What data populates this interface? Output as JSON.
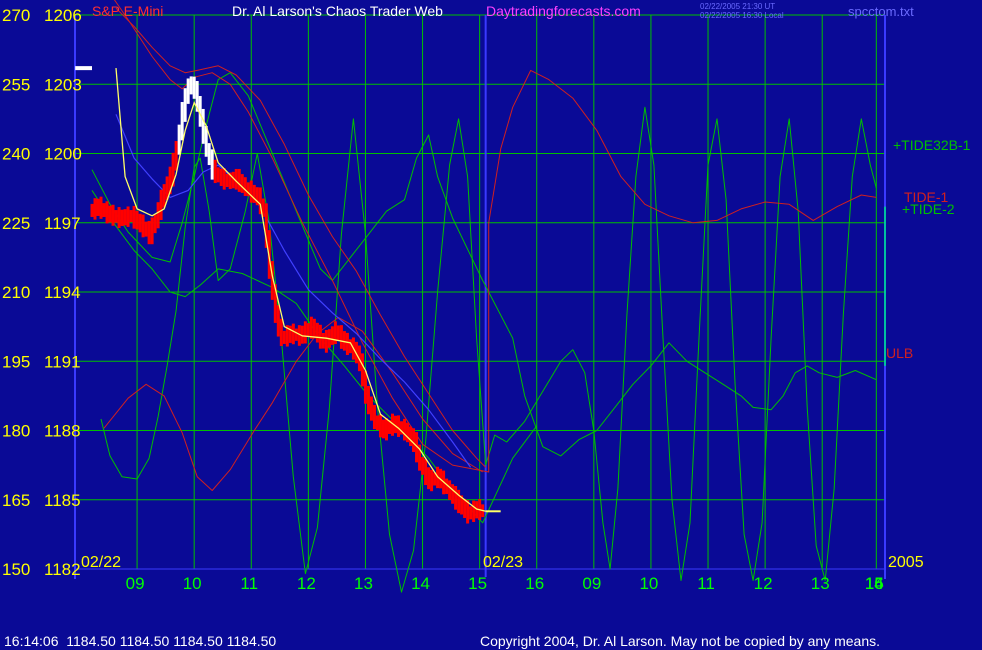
{
  "header": {
    "symbol": "S&P E-Mini",
    "title": "Dr. Al Larson's Chaos Trader Web",
    "site": "Daytradingforecasts.com",
    "timestamp_ut": "02/22/2005 21:30 UT",
    "timestamp_local": "02/22/2005 16:30 Local",
    "file": "spcctom.txt"
  },
  "footer": {
    "quote": "16:14:06  1184.50 1184.50 1184.50 1184.50",
    "copyright": "Copyright 2004, Dr. Al Larson. May not be copied by any means."
  },
  "date_labels": {
    "day1": "02/22",
    "day2": "02/23",
    "year": "2005"
  },
  "colors": {
    "background": "#0a0a96",
    "grid": "#00c000",
    "axis": "#3a3aff",
    "price_up": "#ffffff",
    "price_down": "#ff0000",
    "tide": "#00c000",
    "envelope": "#d02020",
    "ma_fast": "#ffff66",
    "ma_slow": "#4040ff",
    "left_labels": "#ffff00",
    "time_labels": "#00ff00",
    "site": "#ff40ff"
  },
  "chart_data": {
    "type": "line",
    "title": "S&P E-Mini",
    "left_axis_tide": [
      270,
      255,
      240,
      225,
      210,
      195,
      180,
      165,
      150
    ],
    "left_axis_price": [
      1206,
      1203,
      1200,
      1197,
      1194,
      1191,
      1188,
      1185,
      1182
    ],
    "ylim_price": [
      1182,
      1206
    ],
    "x_ticks": [
      "09",
      "10",
      "11",
      "12",
      "13",
      "14",
      "15",
      "16",
      "09",
      "10",
      "11",
      "12",
      "13",
      "14",
      "15",
      "16"
    ],
    "series_labels": [
      "+TIDE32B-1",
      "TIDE-1",
      "+TIDE-2",
      "ULB"
    ],
    "price": [
      [
        0,
        1197.5
      ],
      [
        0.15,
        1197.7
      ],
      [
        0.3,
        1197.4
      ],
      [
        0.5,
        1197.2
      ],
      [
        0.7,
        1197.3
      ],
      [
        0.9,
        1196.8
      ],
      [
        1.0,
        1196.5
      ],
      [
        1.1,
        1197.1
      ],
      [
        1.2,
        1198.0
      ],
      [
        1.35,
        1199.0
      ],
      [
        1.45,
        1200.2
      ],
      [
        1.55,
        1201.8
      ],
      [
        1.65,
        1203.0
      ],
      [
        1.75,
        1202.8
      ],
      [
        1.85,
        1201.5
      ],
      [
        1.95,
        1200.2
      ],
      [
        2.05,
        1199.3
      ],
      [
        2.15,
        1199.0
      ],
      [
        2.3,
        1198.8
      ],
      [
        2.45,
        1198.9
      ],
      [
        2.6,
        1198.5
      ],
      [
        2.8,
        1198.1
      ],
      [
        2.9,
        1197.5
      ],
      [
        3.0,
        1195.0
      ],
      [
        3.1,
        1193.0
      ],
      [
        3.2,
        1192.0
      ],
      [
        3.35,
        1192.2
      ],
      [
        3.5,
        1192.1
      ],
      [
        3.7,
        1192.5
      ],
      [
        3.9,
        1191.8
      ],
      [
        4.1,
        1192.3
      ],
      [
        4.25,
        1191.8
      ],
      [
        4.4,
        1191.5
      ],
      [
        4.5,
        1191.0
      ],
      [
        4.6,
        1189.5
      ],
      [
        4.75,
        1188.4
      ],
      [
        4.9,
        1188.0
      ],
      [
        5.05,
        1188.3
      ],
      [
        5.25,
        1188.0
      ],
      [
        5.4,
        1187.5
      ],
      [
        5.5,
        1186.6
      ],
      [
        5.65,
        1185.8
      ],
      [
        5.8,
        1186.0
      ],
      [
        5.95,
        1185.5
      ],
      [
        6.1,
        1185.0
      ],
      [
        6.3,
        1184.4
      ],
      [
        6.45,
        1184.6
      ],
      [
        6.55,
        1184.5
      ]
    ],
    "ma_fast": [
      [
        0.4,
        1203.7
      ],
      [
        0.55,
        1199.0
      ],
      [
        0.75,
        1197.6
      ],
      [
        1.0,
        1197.3
      ],
      [
        1.2,
        1197.6
      ],
      [
        1.4,
        1199.1
      ],
      [
        1.55,
        1201.0
      ],
      [
        1.7,
        1202.2
      ],
      [
        1.9,
        1201.2
      ],
      [
        2.1,
        1199.6
      ],
      [
        2.4,
        1198.8
      ],
      [
        2.8,
        1197.8
      ],
      [
        3.0,
        1194.7
      ],
      [
        3.2,
        1192.5
      ],
      [
        3.5,
        1192.1
      ],
      [
        3.9,
        1192.0
      ],
      [
        4.3,
        1191.8
      ],
      [
        4.55,
        1190.6
      ],
      [
        4.8,
        1188.7
      ],
      [
        5.1,
        1188.1
      ],
      [
        5.45,
        1187.2
      ],
      [
        5.75,
        1186.0
      ],
      [
        6.1,
        1185.2
      ],
      [
        6.4,
        1184.6
      ],
      [
        6.55,
        1184.5
      ]
    ],
    "ma_slow": [
      [
        0.4,
        1201.7
      ],
      [
        0.7,
        1199.8
      ],
      [
        1.0,
        1198.9
      ],
      [
        1.3,
        1198.1
      ],
      [
        1.6,
        1198.4
      ],
      [
        1.85,
        1199.2
      ],
      [
        2.1,
        1199.5
      ],
      [
        2.4,
        1198.8
      ],
      [
        2.8,
        1197.7
      ],
      [
        3.2,
        1195.8
      ],
      [
        3.6,
        1194.1
      ],
      [
        4.0,
        1193.1
      ],
      [
        4.4,
        1192.2
      ],
      [
        4.8,
        1191.1
      ],
      [
        5.2,
        1190.1
      ],
      [
        5.6,
        1188.9
      ],
      [
        6.0,
        1187.5
      ],
      [
        6.3,
        1186.4
      ]
    ],
    "env_upper": [
      [
        0.4,
        1206.3
      ],
      [
        0.7,
        1205.5
      ],
      [
        1.0,
        1204.6
      ],
      [
        1.3,
        1203.8
      ],
      [
        1.55,
        1203.5
      ],
      [
        1.75,
        1203.6
      ],
      [
        2.1,
        1203.8
      ],
      [
        2.4,
        1203.4
      ],
      [
        2.8,
        1202.3
      ],
      [
        3.2,
        1200.4
      ],
      [
        3.6,
        1198.2
      ],
      [
        4.0,
        1196.4
      ],
      [
        4.4,
        1194.9
      ],
      [
        4.8,
        1193.0
      ],
      [
        5.2,
        1191.2
      ],
      [
        5.6,
        1189.6
      ],
      [
        6.0,
        1188.0
      ],
      [
        6.4,
        1186.8
      ],
      [
        6.55,
        1186.4
      ]
    ],
    "env_lower": [
      [
        0.2,
        1188.1
      ],
      [
        0.6,
        1189.4
      ],
      [
        0.9,
        1190.0
      ],
      [
        1.2,
        1189.5
      ],
      [
        1.5,
        1187.9
      ],
      [
        1.75,
        1186.0
      ],
      [
        2.0,
        1185.4
      ],
      [
        2.3,
        1186.3
      ],
      [
        2.7,
        1188.0
      ],
      [
        3.0,
        1189.2
      ],
      [
        3.4,
        1191.0
      ],
      [
        3.75,
        1192.2
      ],
      [
        4.1,
        1192.9
      ],
      [
        4.5,
        1192.3
      ],
      [
        5.0,
        1190.5
      ],
      [
        5.5,
        1188.5
      ],
      [
        6.0,
        1187.0
      ],
      [
        6.5,
        1186.2
      ]
    ],
    "tide_mid": [
      [
        0.0,
        1198.4
      ],
      [
        0.3,
        1197.2
      ],
      [
        0.7,
        1195.8
      ],
      [
        1.0,
        1195.0
      ],
      [
        1.3,
        1194.0
      ],
      [
        1.55,
        1193.8
      ],
      [
        1.8,
        1194.3
      ],
      [
        2.1,
        1195.0
      ],
      [
        2.5,
        1194.8
      ],
      [
        3.0,
        1194.2
      ],
      [
        3.4,
        1193.5
      ],
      [
        3.8,
        1192.0
      ],
      [
        4.2,
        1190.8
      ],
      [
        4.6,
        1189.5
      ],
      [
        5.1,
        1188.2
      ],
      [
        5.6,
        1186.8
      ],
      [
        6.0,
        1185.4
      ],
      [
        6.5,
        1184.0
      ],
      [
        7.0,
        1186.8
      ],
      [
        7.4,
        1188.2
      ]
    ],
    "tide_wave": [
      [
        0.15,
        1188.5
      ],
      [
        0.3,
        1186.9
      ],
      [
        0.5,
        1186.0
      ],
      [
        0.75,
        1185.9
      ],
      [
        0.95,
        1186.8
      ],
      [
        1.1,
        1188.6
      ],
      [
        1.25,
        1190.8
      ],
      [
        1.4,
        1193.2
      ],
      [
        1.55,
        1196.8
      ],
      [
        1.7,
        1199.4
      ],
      [
        1.8,
        1199.8
      ],
      [
        1.95,
        1197.5
      ],
      [
        2.1,
        1194.5
      ],
      [
        2.3,
        1195.0
      ],
      [
        2.55,
        1197.5
      ],
      [
        2.75,
        1200.0
      ],
      [
        2.95,
        1197.0
      ],
      [
        3.15,
        1192.0
      ],
      [
        3.35,
        1186.0
      ],
      [
        3.55,
        1181.8
      ],
      [
        3.75,
        1183.8
      ],
      [
        3.95,
        1189.0
      ],
      [
        4.15,
        1196.5
      ],
      [
        4.35,
        1201.5
      ],
      [
        4.55,
        1196.5
      ],
      [
        4.75,
        1189.0
      ],
      [
        4.95,
        1183.5
      ],
      [
        5.15,
        1181.0
      ],
      [
        5.35,
        1182.8
      ],
      [
        5.55,
        1187.5
      ],
      [
        5.75,
        1194.0
      ],
      [
        5.95,
        1199.5
      ],
      [
        6.1,
        1201.5
      ],
      [
        6.25,
        1199.0
      ],
      [
        6.4,
        1192.0
      ],
      [
        6.55,
        1186.5
      ],
      [
        6.7,
        1187.8
      ],
      [
        6.9,
        1187.5
      ],
      [
        7.2,
        1188.4
      ],
      [
        7.5,
        1189.7
      ],
      [
        7.8,
        1191.0
      ],
      [
        8.0,
        1191.5
      ],
      [
        8.2,
        1190.5
      ],
      [
        8.35,
        1188.0
      ],
      [
        8.5,
        1184.0
      ],
      [
        8.62,
        1182.0
      ],
      [
        8.75,
        1185.5
      ],
      [
        8.9,
        1193.0
      ],
      [
        9.05,
        1199.0
      ],
      [
        9.2,
        1202.0
      ],
      [
        9.35,
        1199.5
      ],
      [
        9.5,
        1192.0
      ],
      [
        9.65,
        1185.0
      ],
      [
        9.8,
        1181.5
      ],
      [
        9.95,
        1184.0
      ],
      [
        10.1,
        1192.0
      ],
      [
        10.25,
        1199.5
      ],
      [
        10.4,
        1201.5
      ],
      [
        10.55,
        1198.0
      ],
      [
        10.7,
        1190.0
      ],
      [
        10.85,
        1183.5
      ],
      [
        11.0,
        1181.5
      ],
      [
        11.15,
        1184.0
      ],
      [
        11.3,
        1192.0
      ],
      [
        11.45,
        1199.0
      ],
      [
        11.6,
        1201.5
      ],
      [
        11.75,
        1197.5
      ],
      [
        11.9,
        1189.0
      ],
      [
        12.05,
        1183.0
      ],
      [
        12.2,
        1181.5
      ],
      [
        12.35,
        1185.5
      ],
      [
        12.5,
        1193.0
      ],
      [
        12.65,
        1199.0
      ],
      [
        12.8,
        1201.5
      ],
      [
        12.95,
        1199.5
      ],
      [
        13.05,
        1198.5
      ]
    ],
    "red_tide": [
      [
        0.15,
        1207.5
      ],
      [
        0.6,
        1205.8
      ],
      [
        1.0,
        1204.2
      ],
      [
        1.3,
        1203.2
      ],
      [
        1.5,
        1202.8
      ],
      [
        1.7,
        1203.3
      ],
      [
        2.0,
        1203.5
      ],
      [
        2.3,
        1203.0
      ],
      [
        2.6,
        1201.8
      ],
      [
        3.0,
        1199.8
      ],
      [
        3.5,
        1197.0
      ],
      [
        4.0,
        1194.5
      ],
      [
        4.5,
        1191.8
      ],
      [
        5.0,
        1189.4
      ],
      [
        5.5,
        1187.4
      ],
      [
        6.0,
        1186.5
      ],
      [
        6.6,
        1186.2
      ],
      [
        6.6,
        1197.0
      ],
      [
        6.8,
        1200.2
      ],
      [
        7.0,
        1202.0
      ],
      [
        7.3,
        1203.6
      ],
      [
        7.6,
        1203.2
      ],
      [
        8.0,
        1202.4
      ],
      [
        8.4,
        1201.0
      ],
      [
        8.8,
        1199.0
      ],
      [
        9.2,
        1197.8
      ],
      [
        9.6,
        1197.3
      ],
      [
        10.0,
        1197.0
      ],
      [
        10.4,
        1197.1
      ],
      [
        10.8,
        1197.6
      ],
      [
        11.2,
        1197.9
      ],
      [
        11.6,
        1197.8
      ],
      [
        12.0,
        1197.1
      ],
      [
        12.4,
        1197.7
      ],
      [
        12.8,
        1198.2
      ],
      [
        13.05,
        1198.1
      ]
    ],
    "green_tide2": [
      [
        0.0,
        1199.3
      ],
      [
        0.3,
        1197.8
      ],
      [
        0.6,
        1196.6
      ],
      [
        1.0,
        1195.5
      ],
      [
        1.3,
        1195.3
      ],
      [
        1.5,
        1197.0
      ],
      [
        1.7,
        1199.0
      ],
      [
        1.9,
        1201.2
      ],
      [
        2.1,
        1203.2
      ],
      [
        2.3,
        1203.5
      ],
      [
        2.6,
        1202.5
      ],
      [
        3.0,
        1200.0
      ],
      [
        3.4,
        1197.5
      ],
      [
        3.8,
        1195.0
      ],
      [
        4.0,
        1194.5
      ],
      [
        4.3,
        1195.5
      ],
      [
        4.6,
        1196.5
      ],
      [
        4.9,
        1197.5
      ],
      [
        5.2,
        1198.0
      ],
      [
        5.4,
        1199.8
      ],
      [
        5.6,
        1200.8
      ],
      [
        5.75,
        1199.0
      ],
      [
        6.0,
        1197.2
      ],
      [
        6.5,
        1194.5
      ],
      [
        7.0,
        1192.0
      ],
      [
        7.2,
        1189.5
      ],
      [
        7.5,
        1187.3
      ],
      [
        7.8,
        1186.9
      ],
      [
        8.1,
        1187.6
      ],
      [
        8.4,
        1188.0
      ],
      [
        8.7,
        1189.0
      ],
      [
        9.0,
        1190.0
      ],
      [
        9.3,
        1190.8
      ],
      [
        9.6,
        1191.8
      ],
      [
        9.9,
        1191.0
      ],
      [
        10.2,
        1190.5
      ],
      [
        10.5,
        1190.0
      ],
      [
        10.8,
        1189.5
      ],
      [
        11.0,
        1189.0
      ],
      [
        11.3,
        1188.9
      ],
      [
        11.5,
        1189.5
      ],
      [
        11.7,
        1190.5
      ],
      [
        11.9,
        1190.8
      ],
      [
        12.1,
        1190.5
      ],
      [
        12.4,
        1190.3
      ],
      [
        12.7,
        1190.6
      ],
      [
        13.05,
        1190.2
      ]
    ],
    "hour_ticks_x": [
      0.75,
      1.7,
      2.65,
      3.6,
      4.55,
      5.5,
      6.45,
      7.4,
      8.35,
      9.3,
      10.25,
      11.2,
      12.15,
      13.05
    ]
  }
}
